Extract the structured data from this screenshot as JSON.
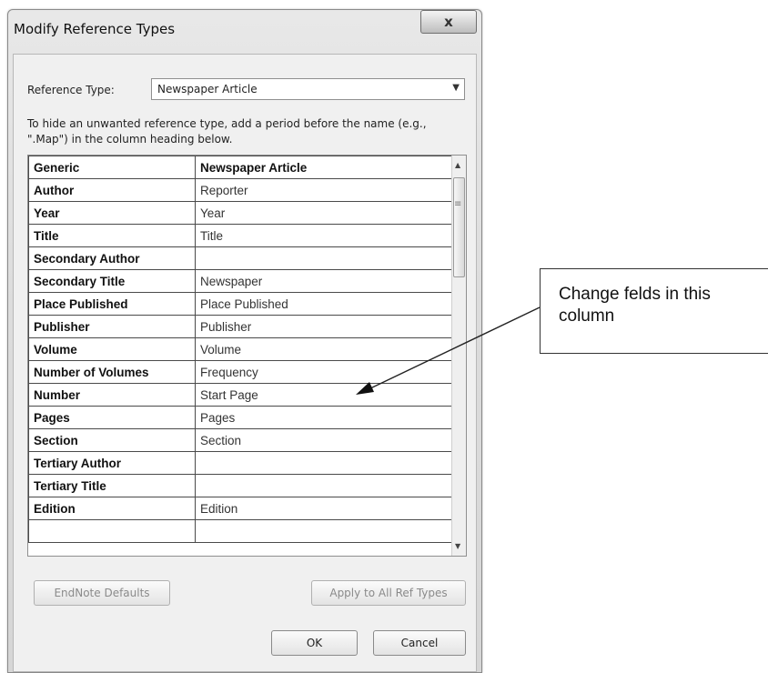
{
  "window": {
    "title": "Modify Reference Types",
    "close_label": "x"
  },
  "reference_type": {
    "label": "Reference Type:",
    "selected": "Newspaper Article"
  },
  "hint": "To hide an unwanted reference type, add a period before the name (e.g., \".Map\") in the column heading below.",
  "grid": {
    "rows": [
      {
        "generic": "Generic",
        "value": "Newspaper Article"
      },
      {
        "generic": "Author",
        "value": "Reporter"
      },
      {
        "generic": "Year",
        "value": "Year"
      },
      {
        "generic": "Title",
        "value": "Title"
      },
      {
        "generic": "Secondary Author",
        "value": ""
      },
      {
        "generic": "Secondary Title",
        "value": "Newspaper"
      },
      {
        "generic": "Place Published",
        "value": "Place Published"
      },
      {
        "generic": "Publisher",
        "value": "Publisher"
      },
      {
        "generic": "Volume",
        "value": "Volume"
      },
      {
        "generic": "Number of Volumes",
        "value": "Frequency"
      },
      {
        "generic": "Number",
        "value": "Start Page"
      },
      {
        "generic": "Pages",
        "value": "Pages"
      },
      {
        "generic": "Section",
        "value": "Section"
      },
      {
        "generic": "Tertiary Author",
        "value": ""
      },
      {
        "generic": "Tertiary Title",
        "value": ""
      },
      {
        "generic": "Edition",
        "value": "Edition"
      },
      {
        "generic": "",
        "value": ""
      }
    ]
  },
  "buttons": {
    "defaults": "EndNote Defaults",
    "apply_all": "Apply to All Ref Types",
    "ok": "OK",
    "cancel": "Cancel"
  },
  "callout": {
    "text": "Change felds in this column"
  },
  "icons": {
    "close": "close-icon",
    "dropdown": "chevron-down-icon",
    "scroll_up": "scroll-up-arrow-icon",
    "scroll_down": "scroll-down-arrow-icon",
    "grip": "scrollbar-grip-icon",
    "pointer": "arrow-pointer"
  }
}
